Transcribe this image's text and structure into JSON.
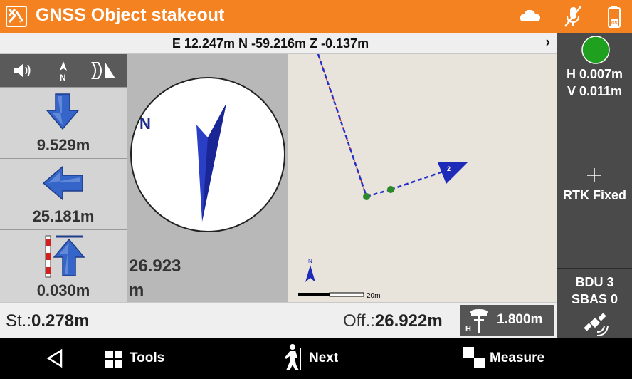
{
  "app": {
    "title": "GNSS Object stakeout"
  },
  "coordinates": {
    "text": "E 12.247m N -59.216m Z -0.137m",
    "chevron": "›"
  },
  "toolbar_icons": [
    "speaker-icon",
    "north-arrow-icon",
    "stakeout-mode-icon"
  ],
  "navigation": {
    "down_distance": "9.529m",
    "left_distance": "25.181m",
    "up_distance": "0.030m"
  },
  "compass": {
    "north_label": "N",
    "distance_value": "26.923",
    "distance_unit": "m"
  },
  "map": {
    "scale_label": "20m",
    "north_label": "N"
  },
  "status": {
    "h_precision": "H 0.007m",
    "v_precision": "V 0.011m",
    "fix_type": "RTK Fixed",
    "bdu_count": "BDU 3",
    "sbas_count": "SBAS 0",
    "fix_color": "#1fa01f"
  },
  "bottom": {
    "station_label": "St.:",
    "station_value": "0.278m",
    "offset_label": "Off.:",
    "offset_value": "26.922m",
    "antenna_height": "1.800m"
  },
  "nav": {
    "tools_label": "Tools",
    "next_label": "Next",
    "measure_label": "Measure"
  },
  "colors": {
    "accent": "#f58220",
    "arrow_blue": "#3565c8",
    "panel_dark": "#4a4a4a"
  }
}
